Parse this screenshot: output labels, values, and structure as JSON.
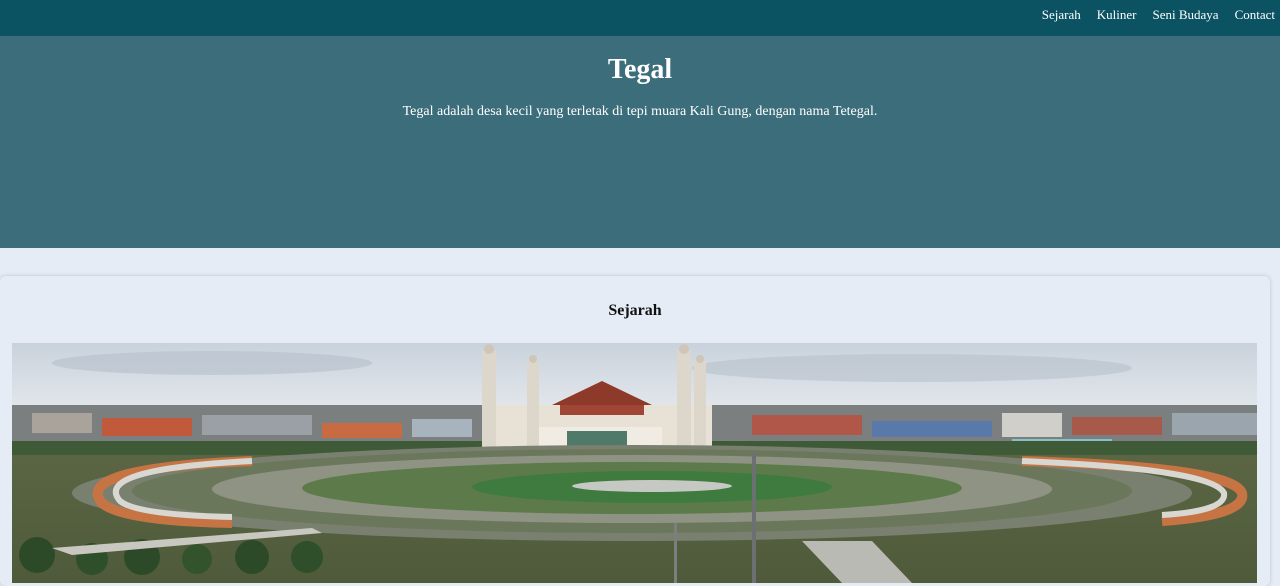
{
  "nav": {
    "items": [
      "Sejarah",
      "Kuliner",
      "Seni Budaya",
      "Contact"
    ]
  },
  "hero": {
    "title": "Tegal",
    "subtitle": "Tegal adalah desa kecil yang terletak di tepi muara Kali Gung, dengan nama Tetegal."
  },
  "section": {
    "title": "Sejarah"
  },
  "colors": {
    "navbar": "#0b5363",
    "hero": "#3b6d7a",
    "page": "#e6ecf5"
  }
}
